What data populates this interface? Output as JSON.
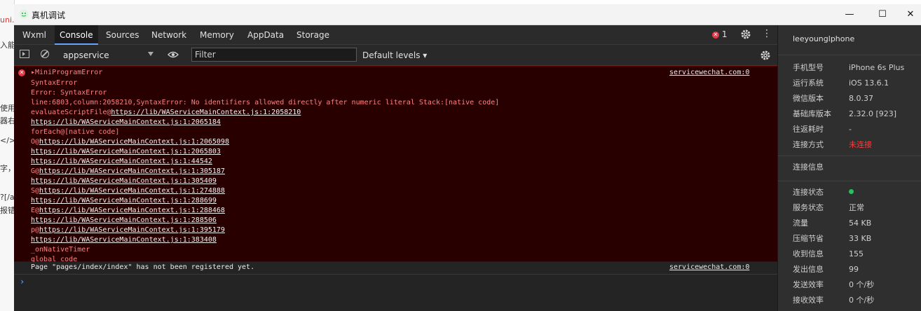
{
  "background": {
    "strip_lines": [
      "uni.",
      "入能",
      "使用",
      "器右",
      "</>",
      "字，",
      "?[/a",
      "报错"
    ]
  },
  "window": {
    "title": "真机调试",
    "controls": {
      "minimize": "—",
      "maximize": "☐",
      "close": "✕"
    }
  },
  "devtools": {
    "tabs": [
      "Wxml",
      "Console",
      "Sources",
      "Network",
      "Memory",
      "AppData",
      "Storage"
    ],
    "active_tab": "Console",
    "error_count": "1",
    "toolbar": {
      "context": "appservice",
      "filter_placeholder": "Filter",
      "levels": "Default levels ▾"
    }
  },
  "console": {
    "error": {
      "header": "▸MiniProgramError",
      "source": "servicewechat.com:0",
      "lines": [
        {
          "pre": "SyntaxError",
          "link": ""
        },
        {
          "pre": "Error: SyntaxError",
          "link": ""
        },
        {
          "pre": "line:6803,column:2058210,SyntaxError: No identifiers allowed directly after numeric literal Stack:[native code]",
          "link": ""
        },
        {
          "pre": "evaluateScriptFile@",
          "link": "https://lib/WAServiceMainContext.js:1:2058210"
        },
        {
          "pre": "",
          "link": "https://lib/WAServiceMainContext.js:1:2065184"
        },
        {
          "pre": "forEach@[native code]",
          "link": ""
        },
        {
          "pre": "O@",
          "link": "https://lib/WAServiceMainContext.js:1:2065098"
        },
        {
          "pre": "",
          "link": "https://lib/WAServiceMainContext.js:1:2065803"
        },
        {
          "pre": "",
          "link": "https://lib/WAServiceMainContext.js:1:44542"
        },
        {
          "pre": "G@",
          "link": "https://lib/WAServiceMainContext.js:1:305187"
        },
        {
          "pre": "",
          "link": "https://lib/WAServiceMainContext.js:1:305409"
        },
        {
          "pre": "S@",
          "link": "https://lib/WAServiceMainContext.js:1:274888"
        },
        {
          "pre": "",
          "link": "https://lib/WAServiceMainContext.js:1:288699"
        },
        {
          "pre": "E@",
          "link": "https://lib/WAServiceMainContext.js:1:288468"
        },
        {
          "pre": "",
          "link": "https://lib/WAServiceMainContext.js:1:288506"
        },
        {
          "pre": "p@",
          "link": "https://lib/WAServiceMainContext.js:1:395179"
        },
        {
          "pre": "",
          "link": "https://lib/WAServiceMainContext.js:1:383408"
        },
        {
          "pre": "_onNativeTimer",
          "link": ""
        },
        {
          "pre": "global code",
          "link": ""
        }
      ]
    },
    "warning": {
      "message": "Page \"pages/index/index\" has not been registered yet.",
      "source": "servicewechat.com:0"
    },
    "prompt": "›"
  },
  "info_panel": {
    "device_name": "leeyounglphone",
    "device_rows": [
      {
        "k": "手机型号",
        "v": "iPhone 6s Plus",
        "style": ""
      },
      {
        "k": "运行系统",
        "v": "iOS 13.6.1",
        "style": ""
      },
      {
        "k": "微信版本",
        "v": "8.0.37",
        "style": ""
      },
      {
        "k": "基础库版本",
        "v": "2.32.0 [923]",
        "style": ""
      },
      {
        "k": "往返耗时",
        "v": "-",
        "style": ""
      },
      {
        "k": "连接方式",
        "v": "未连接",
        "style": "red"
      }
    ],
    "connection_title": "连接信息",
    "connection_rows": [
      {
        "k": "连接状态",
        "v": "",
        "style": "dot"
      },
      {
        "k": "服务状态",
        "v": "正常",
        "style": ""
      },
      {
        "k": "流量",
        "v": "54 KB",
        "style": ""
      },
      {
        "k": "压缩节省",
        "v": "33 KB",
        "style": ""
      },
      {
        "k": "收到信息",
        "v": "155",
        "style": ""
      },
      {
        "k": "发出信息",
        "v": "99",
        "style": ""
      },
      {
        "k": "发送效率",
        "v": "0 个/秒",
        "style": ""
      },
      {
        "k": "接收效率",
        "v": "0 个/秒",
        "style": ""
      }
    ],
    "colors": {
      "status_green": "#21c35a",
      "error_red": "#ff3b3b"
    }
  }
}
